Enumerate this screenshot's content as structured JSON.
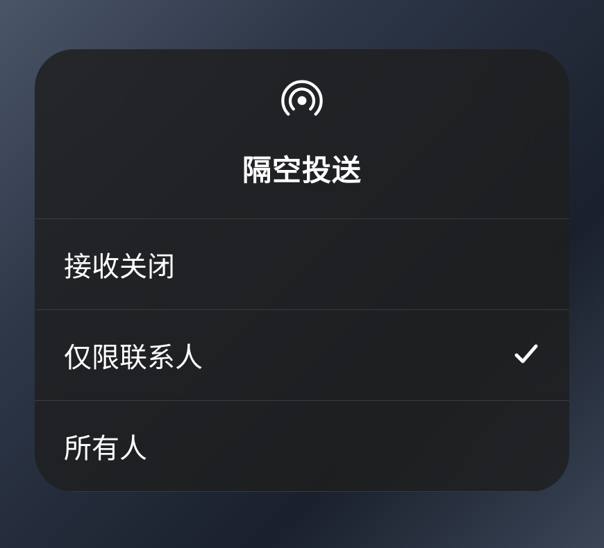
{
  "title": "隔空投送",
  "icon": "airdrop-icon",
  "options": [
    {
      "label": "接收关闭",
      "selected": false
    },
    {
      "label": "仅限联系人",
      "selected": true
    },
    {
      "label": "所有人",
      "selected": false
    }
  ]
}
